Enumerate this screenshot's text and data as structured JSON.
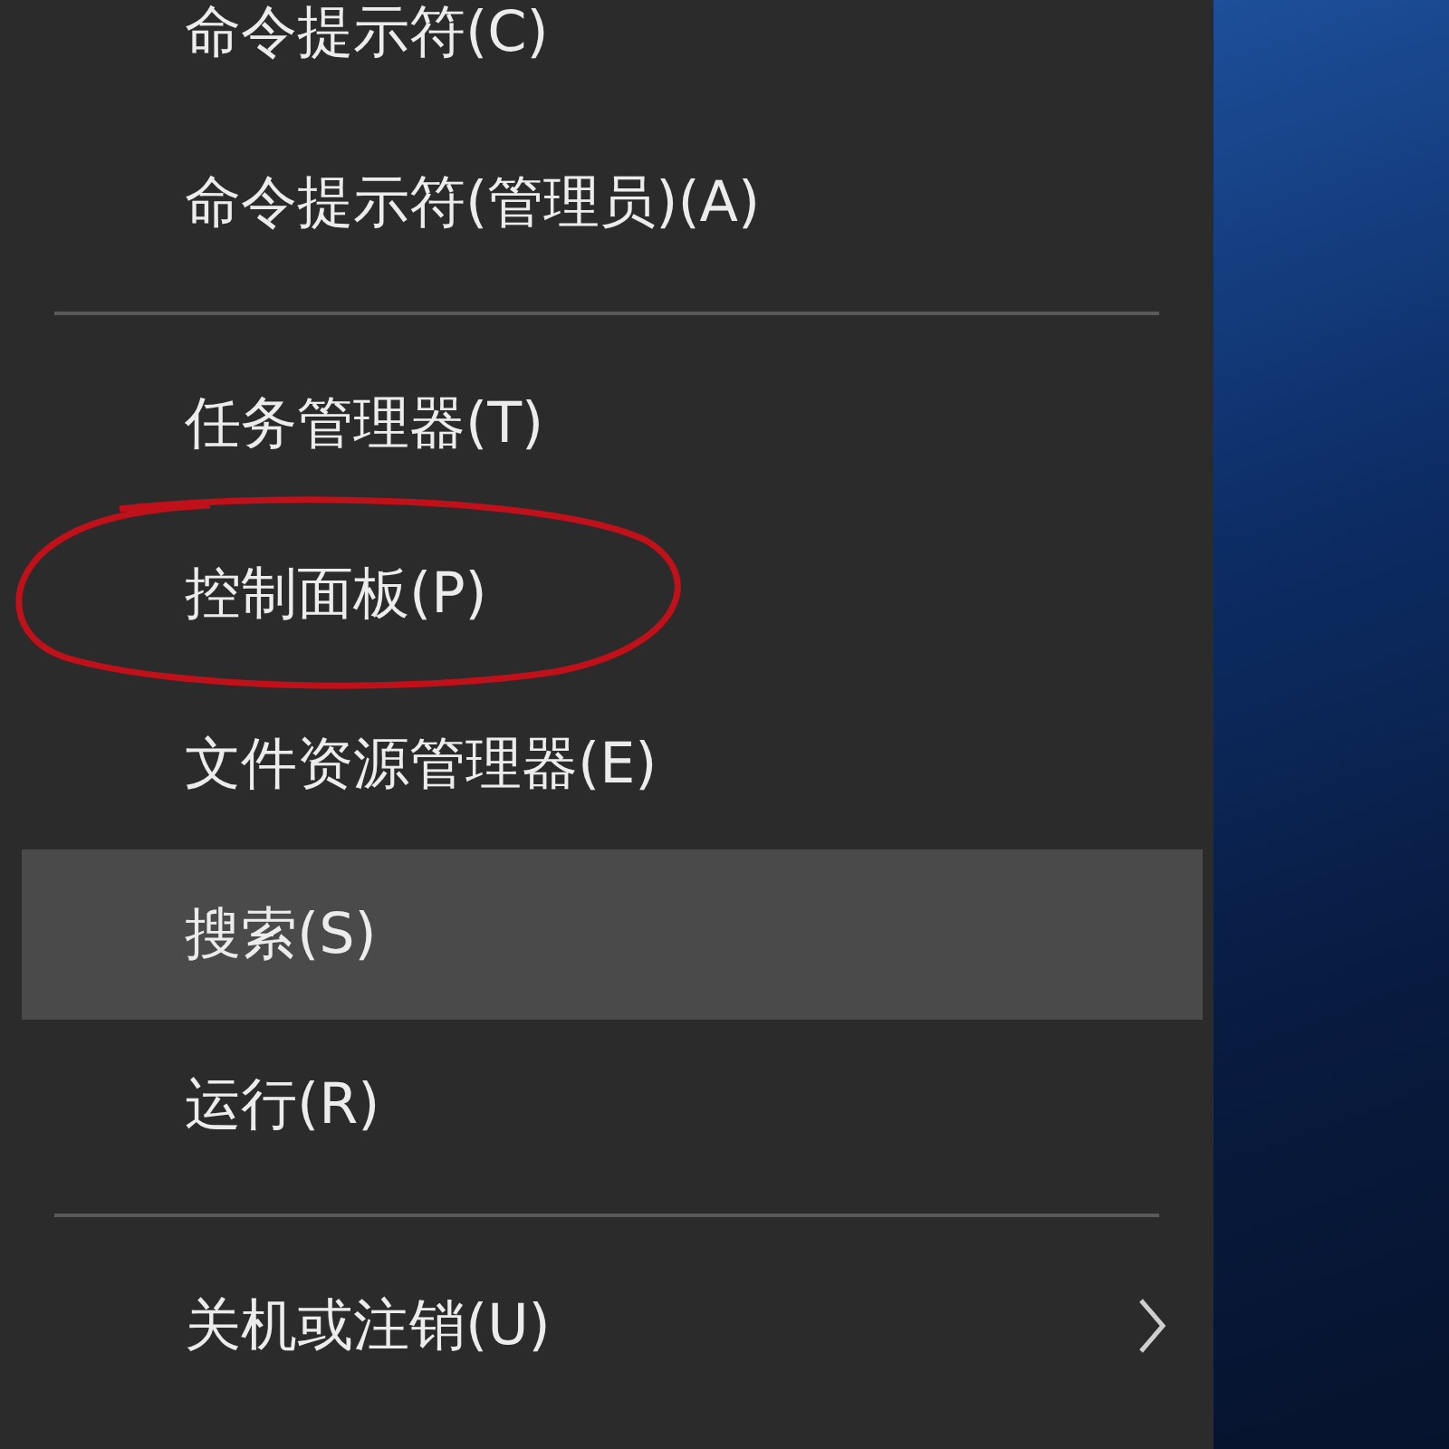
{
  "menu": {
    "sections": [
      {
        "items": [
          {
            "label": "命令提示符(C)",
            "hovered": false,
            "circled": false,
            "submenu": false
          },
          {
            "label": "命令提示符(管理员)(A)",
            "hovered": false,
            "circled": false,
            "submenu": false
          }
        ]
      },
      {
        "items": [
          {
            "label": "任务管理器(T)",
            "hovered": false,
            "circled": false,
            "submenu": false
          },
          {
            "label": "控制面板(P)",
            "hovered": false,
            "circled": true,
            "submenu": false
          },
          {
            "label": "文件资源管理器(E)",
            "hovered": false,
            "circled": false,
            "submenu": false
          },
          {
            "label": "搜索(S)",
            "hovered": true,
            "circled": false,
            "submenu": false
          },
          {
            "label": "运行(R)",
            "hovered": false,
            "circled": false,
            "submenu": false
          }
        ]
      },
      {
        "items": [
          {
            "label": "关机或注销(U)",
            "hovered": false,
            "circled": false,
            "submenu": true
          }
        ]
      }
    ]
  }
}
